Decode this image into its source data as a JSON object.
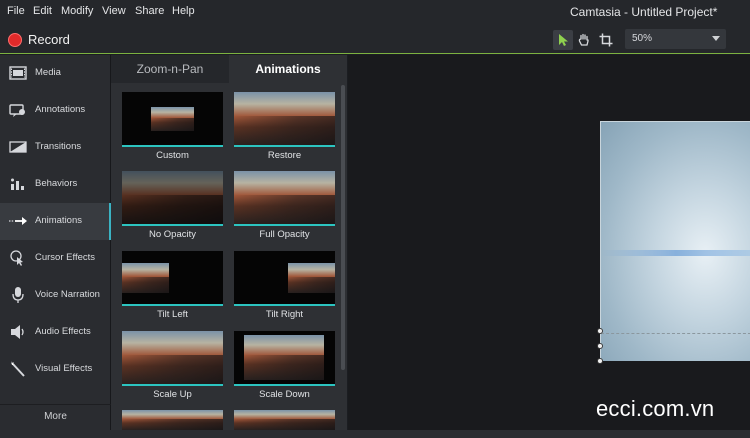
{
  "menu": {
    "items": [
      "File",
      "Edit",
      "Modify",
      "View",
      "Share",
      "Help"
    ],
    "app_title": "Camtasia - Untitled Project*"
  },
  "toolbar": {
    "record_label": "Record",
    "tools": [
      {
        "icon": "arrow-pointer-icon",
        "active": true
      },
      {
        "icon": "hand-pan-icon",
        "active": false
      },
      {
        "icon": "crop-icon",
        "active": false
      }
    ],
    "zoom_value": "50%"
  },
  "sidebar": {
    "items": [
      {
        "label": "Media",
        "icon": "media-film-icon"
      },
      {
        "label": "Annotations",
        "icon": "annotation-callout-icon"
      },
      {
        "label": "Transitions",
        "icon": "transition-icon"
      },
      {
        "label": "Behaviors",
        "icon": "behaviors-bars-icon"
      },
      {
        "label": "Animations",
        "icon": "animation-arrow-icon",
        "active": true
      },
      {
        "label": "Cursor Effects",
        "icon": "cursor-effects-icon"
      },
      {
        "label": "Voice Narration",
        "icon": "microphone-icon"
      },
      {
        "label": "Audio Effects",
        "icon": "speaker-icon"
      },
      {
        "label": "Visual Effects",
        "icon": "magic-wand-icon"
      }
    ],
    "more_label": "More"
  },
  "library": {
    "tabs": [
      "Zoom-n-Pan",
      "Animations"
    ],
    "active_tab": "Animations",
    "thumbnails": [
      {
        "label": "Custom"
      },
      {
        "label": "Restore"
      },
      {
        "label": "No Opacity"
      },
      {
        "label": "Full Opacity"
      },
      {
        "label": "Tilt Left"
      },
      {
        "label": "Tilt Right"
      },
      {
        "label": "Scale Up"
      },
      {
        "label": "Scale Down"
      }
    ]
  },
  "watermark": "ecci.com.vn",
  "colors": {
    "accent_teal": "#2cc4c0",
    "record_red": "#e22a2a",
    "toolbar_line": "#7cb240"
  }
}
